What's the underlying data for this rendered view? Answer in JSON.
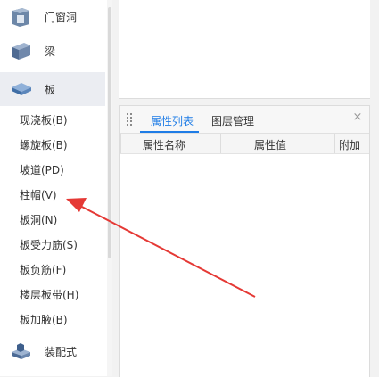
{
  "sidebar": {
    "categories": [
      {
        "label": "门窗洞",
        "icon": "door-window-opening-icon"
      },
      {
        "label": "梁",
        "icon": "beam-icon"
      },
      {
        "label": "板",
        "icon": "slab-icon"
      },
      {
        "label": "装配式",
        "icon": "prefab-icon"
      }
    ],
    "slab_items": [
      "现浇板(B)",
      "螺旋板(B)",
      "坡道(PD)",
      "柱帽(V)",
      "板洞(N)",
      "板受力筋(S)",
      "板负筋(F)",
      "楼层板带(H)",
      "板加腋(B)"
    ]
  },
  "property_panel": {
    "tabs": [
      {
        "label": "属性列表"
      },
      {
        "label": "图层管理"
      }
    ],
    "close": "×",
    "columns": [
      "属性名称",
      "属性值",
      "附加"
    ]
  },
  "colors": {
    "accent": "#1e7ce6",
    "arrow": "#e53935",
    "sidebar_active_bg": "#ebedf2"
  }
}
